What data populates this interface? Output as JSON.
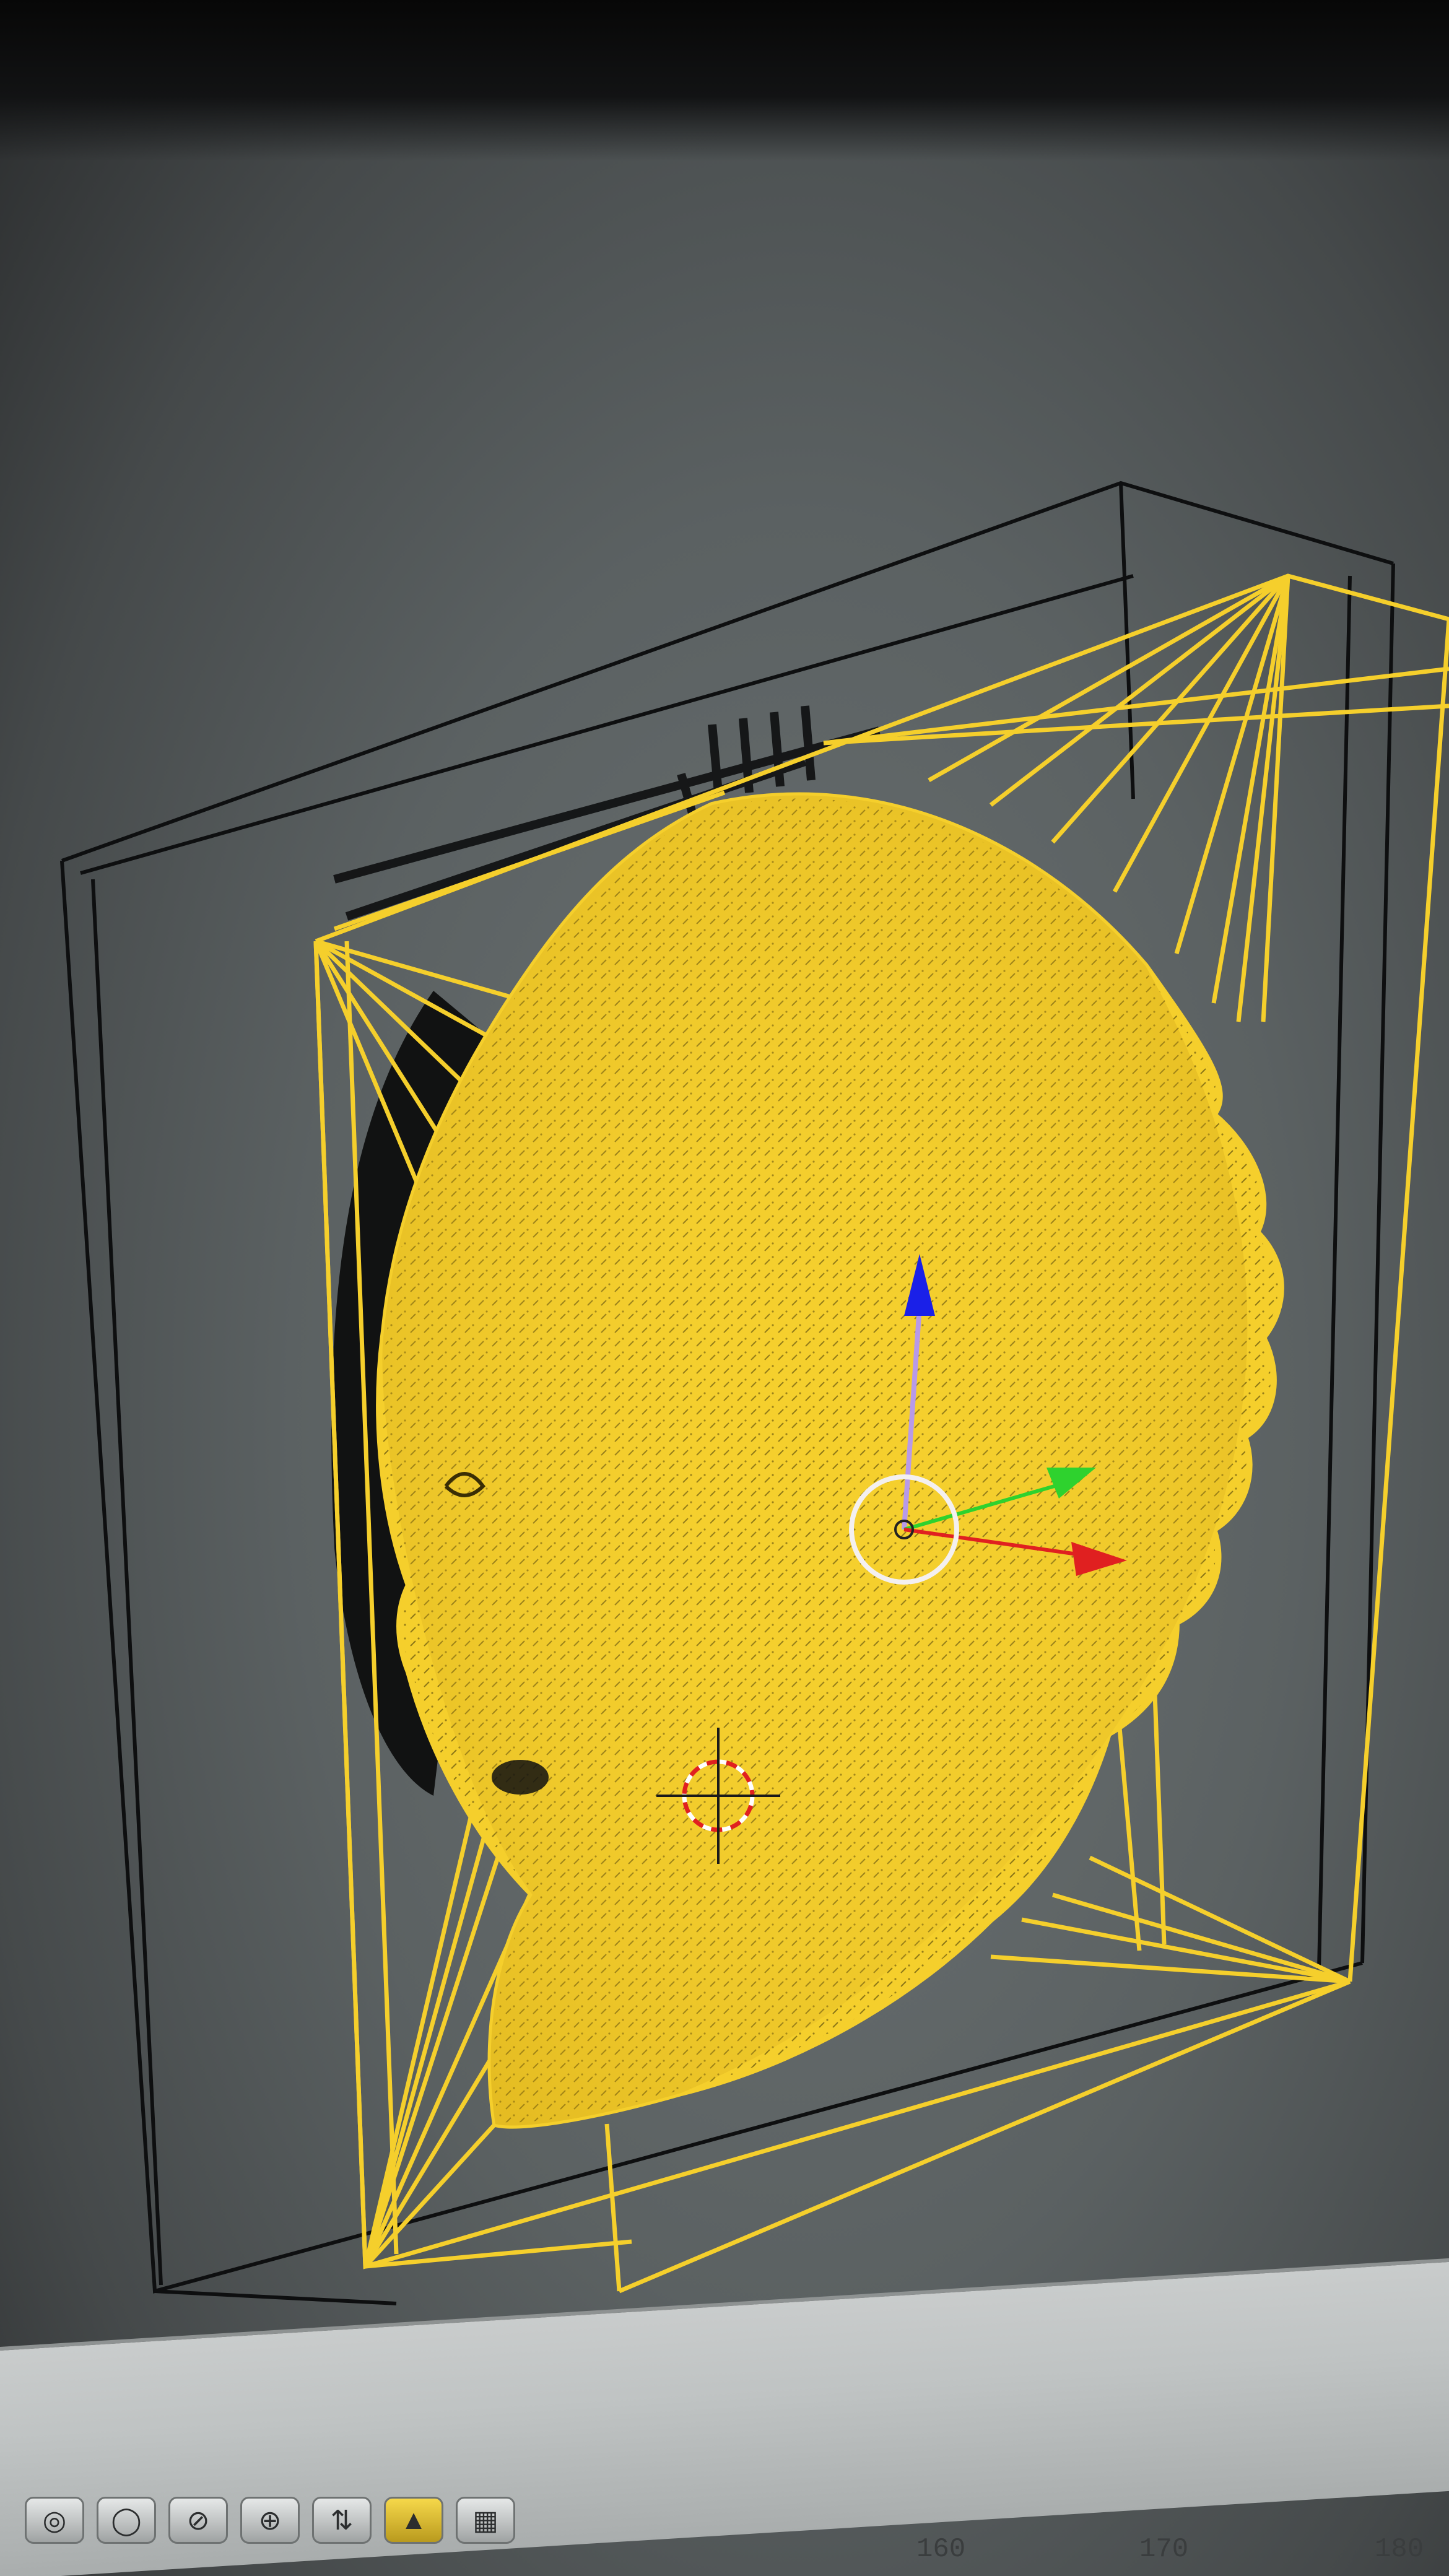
{
  "viewport": {
    "object_color": "#f5cf2c",
    "bounds_color": "#0e0f10",
    "gizmo": {
      "x_axis_color": "#e02020",
      "y_axis_color": "#2ed22e",
      "z_axis_color": "#1a20e8"
    }
  },
  "toolbar": {
    "buttons": [
      {
        "icon": "render-icon",
        "glyph": "◎"
      },
      {
        "icon": "sphere-icon",
        "glyph": "◯"
      },
      {
        "icon": "shading-icon",
        "glyph": "⊘"
      },
      {
        "icon": "pivot-icon",
        "glyph": "⊕"
      },
      {
        "icon": "snap-icon",
        "glyph": "⇅"
      },
      {
        "icon": "manipulator-icon",
        "glyph": "▲"
      },
      {
        "icon": "layers-icon",
        "glyph": "▦"
      }
    ]
  },
  "timeline": {
    "tick_labels": [
      "160",
      "170",
      "180"
    ]
  }
}
